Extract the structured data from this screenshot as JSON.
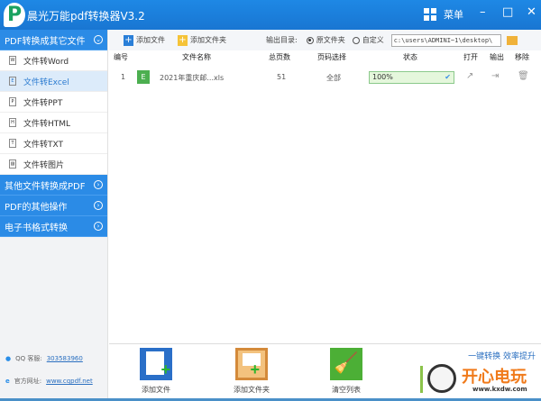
{
  "title": "晨光万能pdf转换器V3.2",
  "menu_label": "菜单",
  "window_controls": {
    "minimize": "–",
    "maximize": "□",
    "close": "✕"
  },
  "sidebar": {
    "sections": [
      {
        "label": "PDF转换成其它文件",
        "expanded": true
      },
      {
        "label": "其他文件转换成PDF",
        "expanded": false
      },
      {
        "label": "PDF的其他操作",
        "expanded": false
      },
      {
        "label": "电子书格式转换",
        "expanded": false
      }
    ],
    "items": [
      {
        "label": "文件转Word",
        "icon": "word-file-icon",
        "glyph": "W"
      },
      {
        "label": "文件转Excel",
        "icon": "excel-file-icon",
        "glyph": "E",
        "selected": true
      },
      {
        "label": "文件转PPT",
        "icon": "ppt-file-icon",
        "glyph": "P"
      },
      {
        "label": "文件转HTML",
        "icon": "html-file-icon",
        "glyph": "H"
      },
      {
        "label": "文件转TXT",
        "icon": "txt-file-icon",
        "glyph": "T"
      },
      {
        "label": "文件转图片",
        "icon": "image-file-icon",
        "glyph": "▨"
      }
    ],
    "qq_label": "QQ 客服:",
    "qq_value": "303583960",
    "site_label": "官方网址:",
    "site_value": "www.cqpdf.net"
  },
  "toolbar": {
    "add_file": "添加文件",
    "add_folder": "添加文件夹",
    "output_label": "输出目录:",
    "opt_source": "原文件夹",
    "opt_custom": "自定义",
    "path": "c:\\users\\ADMINI~1\\desktop\\",
    "selected_option": "原文件夹"
  },
  "table": {
    "headers": [
      "编号",
      "文件名称",
      "总页数",
      "页码选择",
      "状态",
      "打开",
      "输出",
      "移除"
    ],
    "rows": [
      {
        "index": "1",
        "badge": "E",
        "name": "2021年重庆邮...xls",
        "pages": "51",
        "range": "全部",
        "status": "100%",
        "progress": 100
      }
    ]
  },
  "bottom": {
    "add_file": "添加文件",
    "add_folder": "添加文件夹",
    "clear": "清空列表",
    "slogan": "一键转换  效率提升"
  },
  "watermark": {
    "text": "开心电玩",
    "url": "www.kxdw.com"
  },
  "colors": {
    "primary": "#2b8be6",
    "title": "#1e88e5",
    "selected": "#dcebfa",
    "progress": "#e5f7dc"
  }
}
